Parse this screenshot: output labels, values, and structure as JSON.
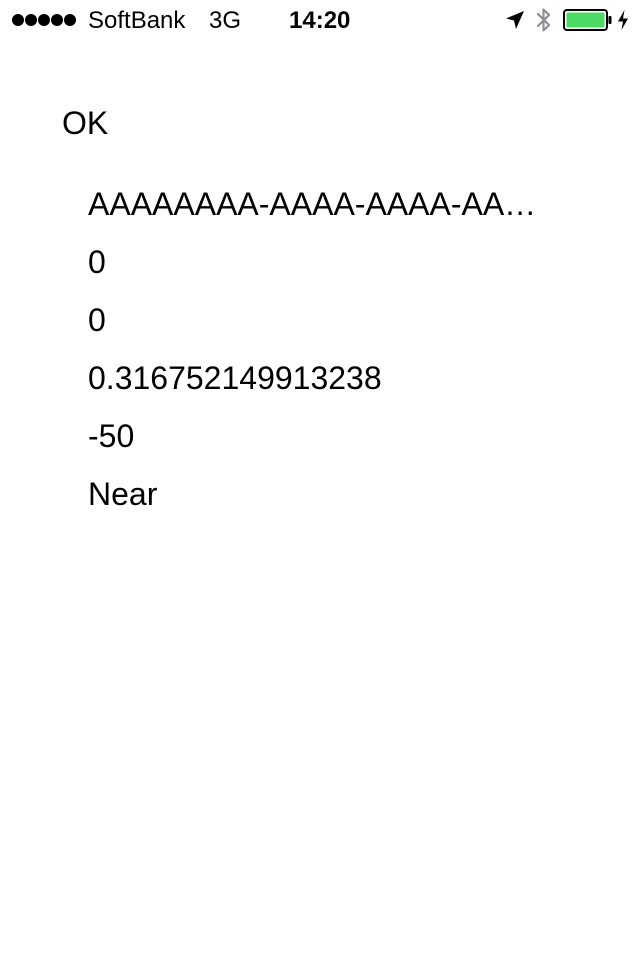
{
  "status_bar": {
    "signal_bars": 5,
    "carrier": "SoftBank",
    "network": "3G",
    "time": "14:20",
    "icons": [
      "location-arrow-icon",
      "bluetooth-icon",
      "battery-icon",
      "charging-bolt-icon"
    ],
    "battery_level": 1.0,
    "battery_color": "#4cd964"
  },
  "main": {
    "status": "OK",
    "values": [
      "AAAAAAAA-AAAA-AAAA-AA…",
      "0",
      "0",
      "0.316752149913238",
      "-50",
      "Near"
    ]
  }
}
